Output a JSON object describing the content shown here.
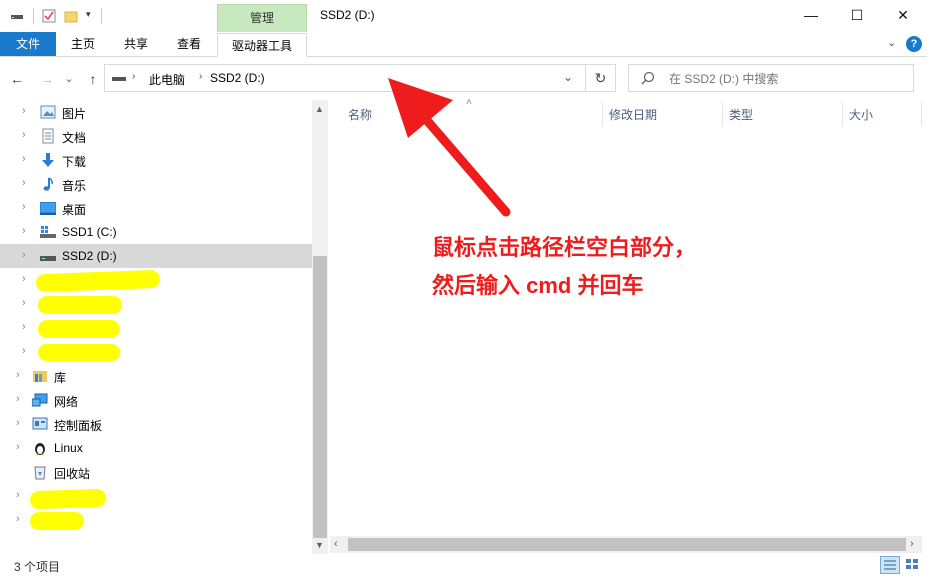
{
  "window": {
    "title": "SSD2 (D:)",
    "context_tab": "管理",
    "buttons": {
      "minimize": "—",
      "maximize": "☐",
      "close": "✕"
    }
  },
  "ribbon": {
    "tabs": [
      "文件",
      "主页",
      "共享",
      "查看",
      "驱动器工具"
    ]
  },
  "address": {
    "back": "←",
    "forward": "→",
    "recent": "⌄",
    "up": "↑",
    "path": [
      "此电脑",
      "SSD2 (D:)"
    ],
    "separator": "›",
    "refresh": "↻"
  },
  "search": {
    "placeholder": "在 SSD2 (D:) 中搜索"
  },
  "nav_tree": [
    {
      "label": "图片",
      "icon": "pictures-icon"
    },
    {
      "label": "文档",
      "icon": "documents-icon"
    },
    {
      "label": "下载",
      "icon": "downloads-icon"
    },
    {
      "label": "音乐",
      "icon": "music-icon"
    },
    {
      "label": "桌面",
      "icon": "desktop-icon"
    },
    {
      "label": "SSD1 (C:)",
      "icon": "windows-drive-icon"
    },
    {
      "label": "SSD2 (D:)",
      "icon": "drive-icon",
      "selected": true
    },
    {
      "label": "",
      "icon": "drive-icon",
      "redacted": true
    },
    {
      "label": "",
      "icon": "drive-icon",
      "redacted": true
    },
    {
      "label": "",
      "icon": "drive-icon",
      "redacted": true
    },
    {
      "label": "",
      "icon": "drive-icon",
      "redacted": true
    },
    {
      "label": "库",
      "icon": "library-icon"
    },
    {
      "label": "网络",
      "icon": "network-icon"
    },
    {
      "label": "控制面板",
      "icon": "control-panel-icon"
    },
    {
      "label": "Linux",
      "icon": "linux-icon"
    },
    {
      "label": "回收站",
      "icon": "recycle-bin-icon"
    },
    {
      "label": "",
      "icon": "folder-icon",
      "redacted": true
    },
    {
      "label": "",
      "icon": "folder-icon",
      "redacted": true
    }
  ],
  "columns": [
    "名称",
    "修改日期",
    "类型",
    "大小"
  ],
  "status": {
    "item_count": "3 个项目"
  },
  "annotation": {
    "line1": "鼠标点击路径栏空白部分，",
    "line2": "然后输入 cmd 并回车"
  },
  "colors": {
    "accent": "#1979ca",
    "context_tab": "#c8e8c0",
    "annotation": "#ee1c1c",
    "highlight": "#ffff00",
    "selection": "#d9d9d9"
  }
}
